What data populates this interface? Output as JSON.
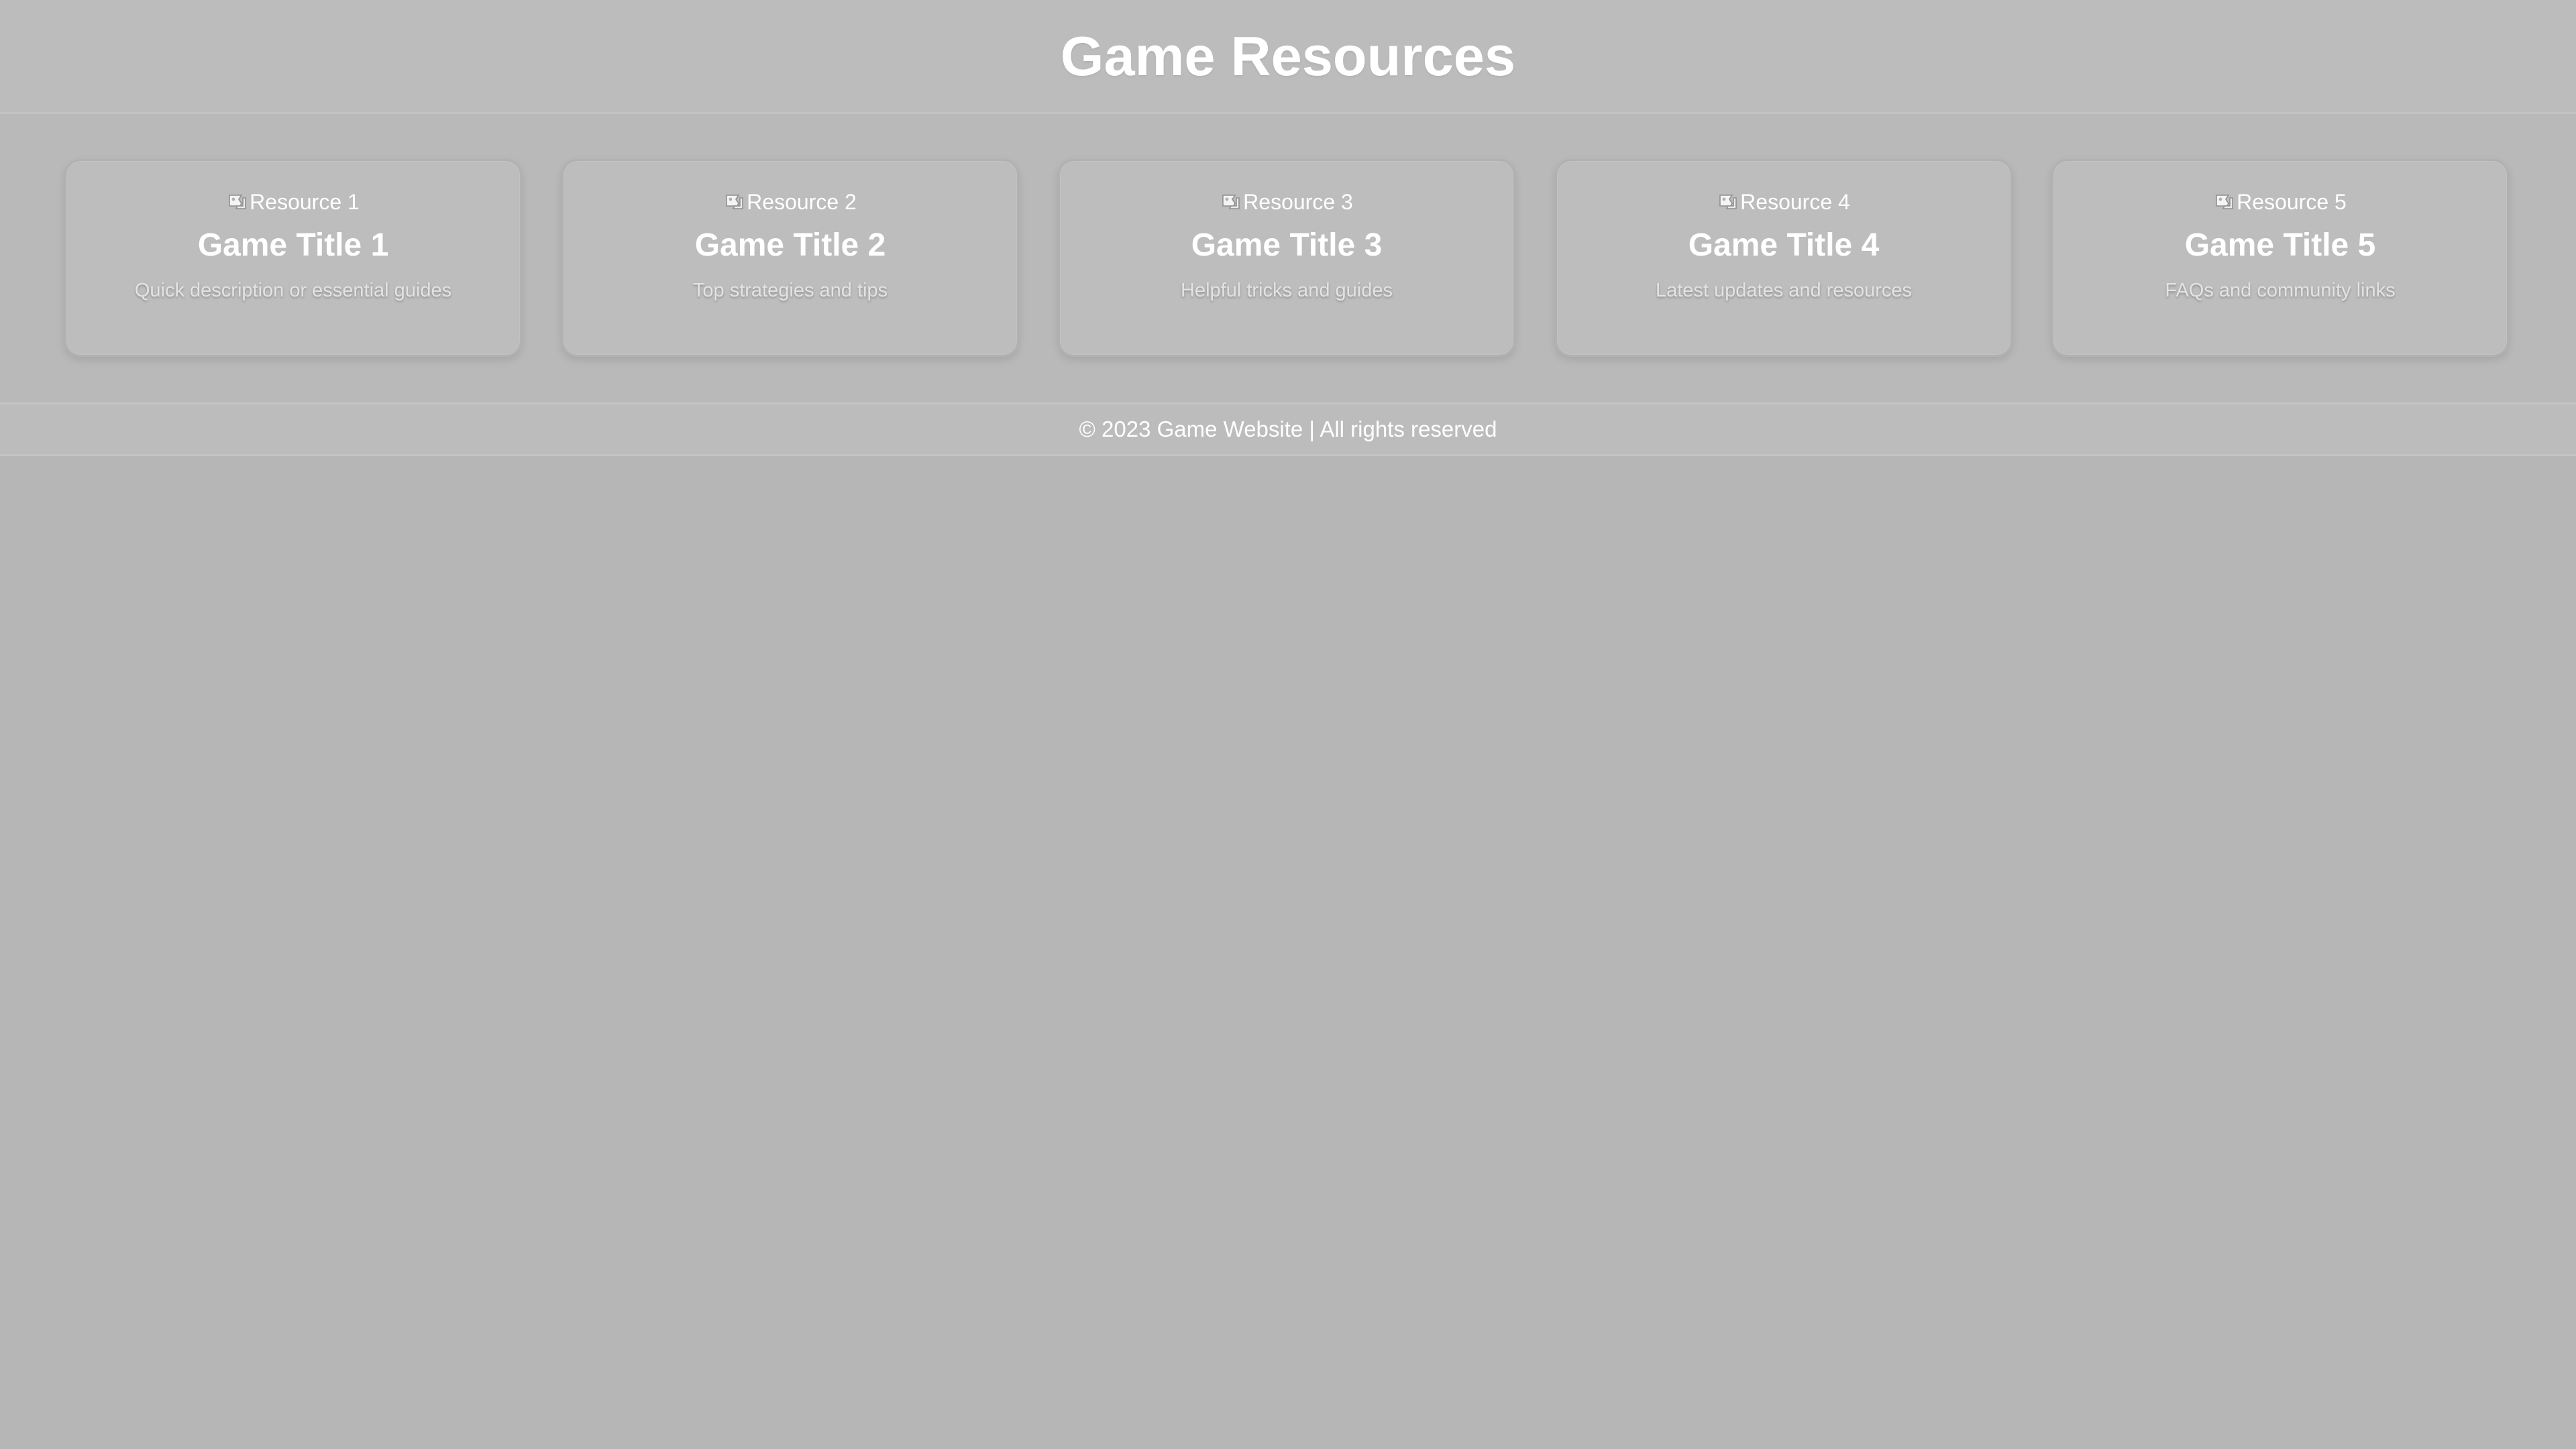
{
  "header": {
    "title": "Game Resources"
  },
  "icons": {
    "image_placeholder": "broken-image-icon"
  },
  "cards": [
    {
      "image_alt": "Resource 1",
      "title": "Game Title 1",
      "description": "Quick description or essential guides"
    },
    {
      "image_alt": "Resource 2",
      "title": "Game Title 2",
      "description": "Top strategies and tips"
    },
    {
      "image_alt": "Resource 3",
      "title": "Game Title 3",
      "description": "Helpful tricks and guides"
    },
    {
      "image_alt": "Resource 4",
      "title": "Game Title 4",
      "description": "Latest updates and resources"
    },
    {
      "image_alt": "Resource 5",
      "title": "Game Title 5",
      "description": "FAQs and community links"
    }
  ],
  "footer": {
    "text": "© 2023 Game Website | All rights reserved"
  },
  "colors": {
    "page_background": "#b6b6b6",
    "card_background": "#bdbdbd",
    "text": "#ffffff"
  }
}
